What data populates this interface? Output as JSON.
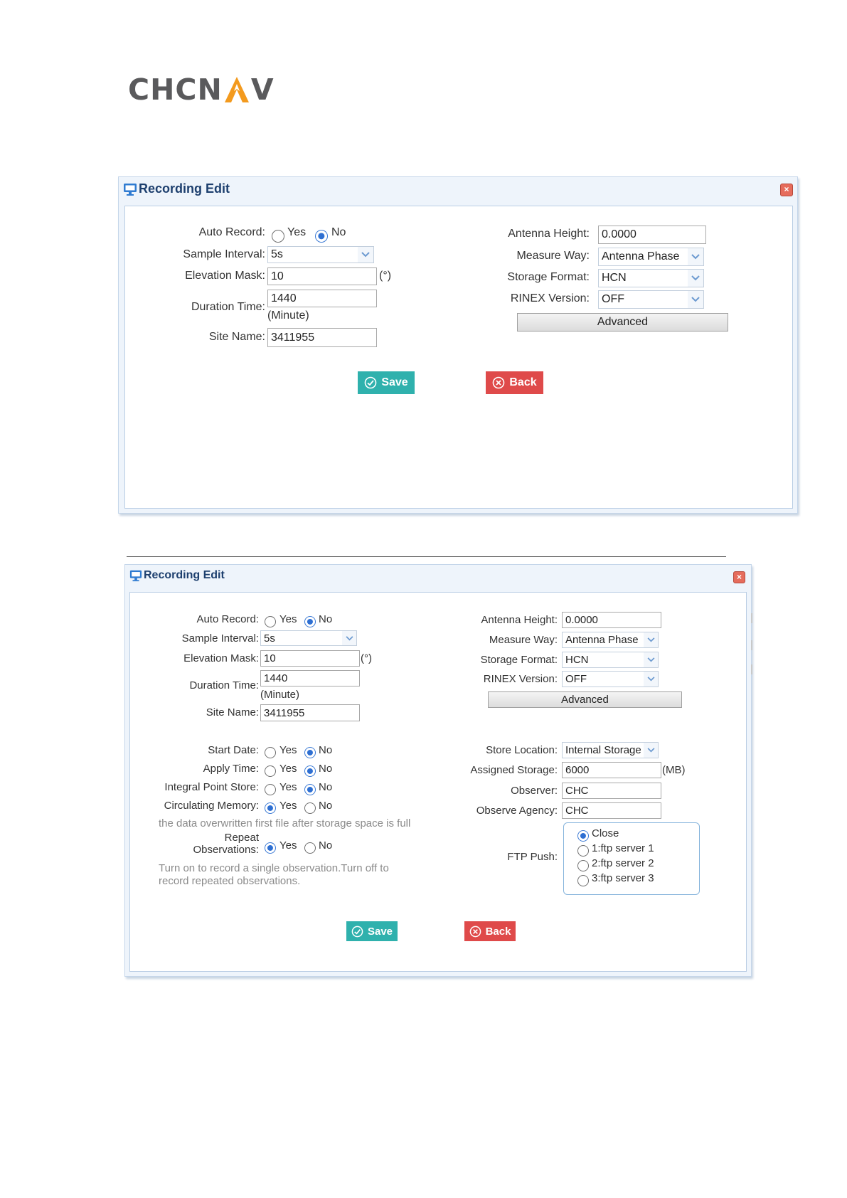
{
  "brand": {
    "logo_text_left": "CHCN",
    "logo_text_right": "V",
    "logo_full": "CHCNAV"
  },
  "dialog1": {
    "title": "Recording Edit",
    "auto_record": {
      "label": "Auto Record:",
      "yes": "Yes",
      "no": "No",
      "selected": "No"
    },
    "sample_interval": {
      "label": "Sample Interval:",
      "value": "5s"
    },
    "elevation_mask": {
      "label": "Elevation Mask:",
      "value": "10",
      "unit": "(°)"
    },
    "duration_time": {
      "label": "Duration Time:",
      "value": "1440",
      "unit": "(Minute)"
    },
    "site_name": {
      "label": "Site Name:",
      "value": "3411955"
    },
    "antenna_height": {
      "label": "Antenna Height:",
      "value": "0.0000"
    },
    "measure_way": {
      "label": "Measure Way:",
      "value": "Antenna Phase"
    },
    "storage_format": {
      "label": "Storage Format:",
      "value": "HCN"
    },
    "rinex_version": {
      "label": "RINEX Version:",
      "value": "OFF"
    },
    "advanced_label": "Advanced",
    "save_label": "Save",
    "back_label": "Back"
  },
  "dialog2": {
    "title": "Recording Edit",
    "auto_record": {
      "label": "Auto Record:",
      "yes": "Yes",
      "no": "No",
      "selected": "No"
    },
    "sample_interval": {
      "label": "Sample Interval:",
      "value": "5s"
    },
    "elevation_mask": {
      "label": "Elevation Mask:",
      "value": "10",
      "unit": "(°)"
    },
    "duration_time": {
      "label": "Duration Time:",
      "value": "1440",
      "unit": "(Minute)"
    },
    "site_name": {
      "label": "Site Name:",
      "value": "3411955"
    },
    "antenna_height": {
      "label": "Antenna Height:",
      "value": "0.0000"
    },
    "measure_way": {
      "label": "Measure Way:",
      "value": "Antenna Phase"
    },
    "storage_format": {
      "label": "Storage Format:",
      "value": "HCN"
    },
    "rinex_version": {
      "label": "RINEX Version:",
      "value": "OFF"
    },
    "advanced_label": "Advanced",
    "start_date": {
      "label": "Start Date:",
      "yes": "Yes",
      "no": "No",
      "selected": "No"
    },
    "apply_time": {
      "label": "Apply Time:",
      "yes": "Yes",
      "no": "No",
      "selected": "No"
    },
    "integral_point_store": {
      "label": "Integral Point Store:",
      "yes": "Yes",
      "no": "No",
      "selected": "No"
    },
    "circulating_memory": {
      "label": "Circulating Memory:",
      "yes": "Yes",
      "no": "No",
      "selected": "Yes",
      "hint": "the data overwritten first file after storage space is full"
    },
    "repeat_observations": {
      "label_line1": "Repeat",
      "label_line2": "Observations:",
      "yes": "Yes",
      "no": "No",
      "selected": "Yes",
      "hint_line1": "Turn on to record a single observation.Turn off to",
      "hint_line2": "record repeated observations."
    },
    "store_location": {
      "label": "Store Location:",
      "value": "Internal Storage"
    },
    "assigned_storage": {
      "label": "Assigned Storage:",
      "value": "6000",
      "unit": "(MB)"
    },
    "observer": {
      "label": "Observer:",
      "value": "CHC"
    },
    "observe_agency": {
      "label": "Observe Agency:",
      "value": "CHC"
    },
    "ftp_push": {
      "label": "FTP Push:",
      "options": [
        "Close",
        "1:ftp server 1",
        "2:ftp server 2",
        "3:ftp server 3"
      ],
      "selected": "Close"
    },
    "save_label": "Save",
    "back_label": "Back"
  },
  "colors": {
    "save": "#2fb1ad",
    "back": "#df4a4a",
    "title": "#1d3f6e",
    "radio_on": "#2e6fd2",
    "logo_grey": "#5a5a5c",
    "logo_orange": "#f39a1e"
  }
}
